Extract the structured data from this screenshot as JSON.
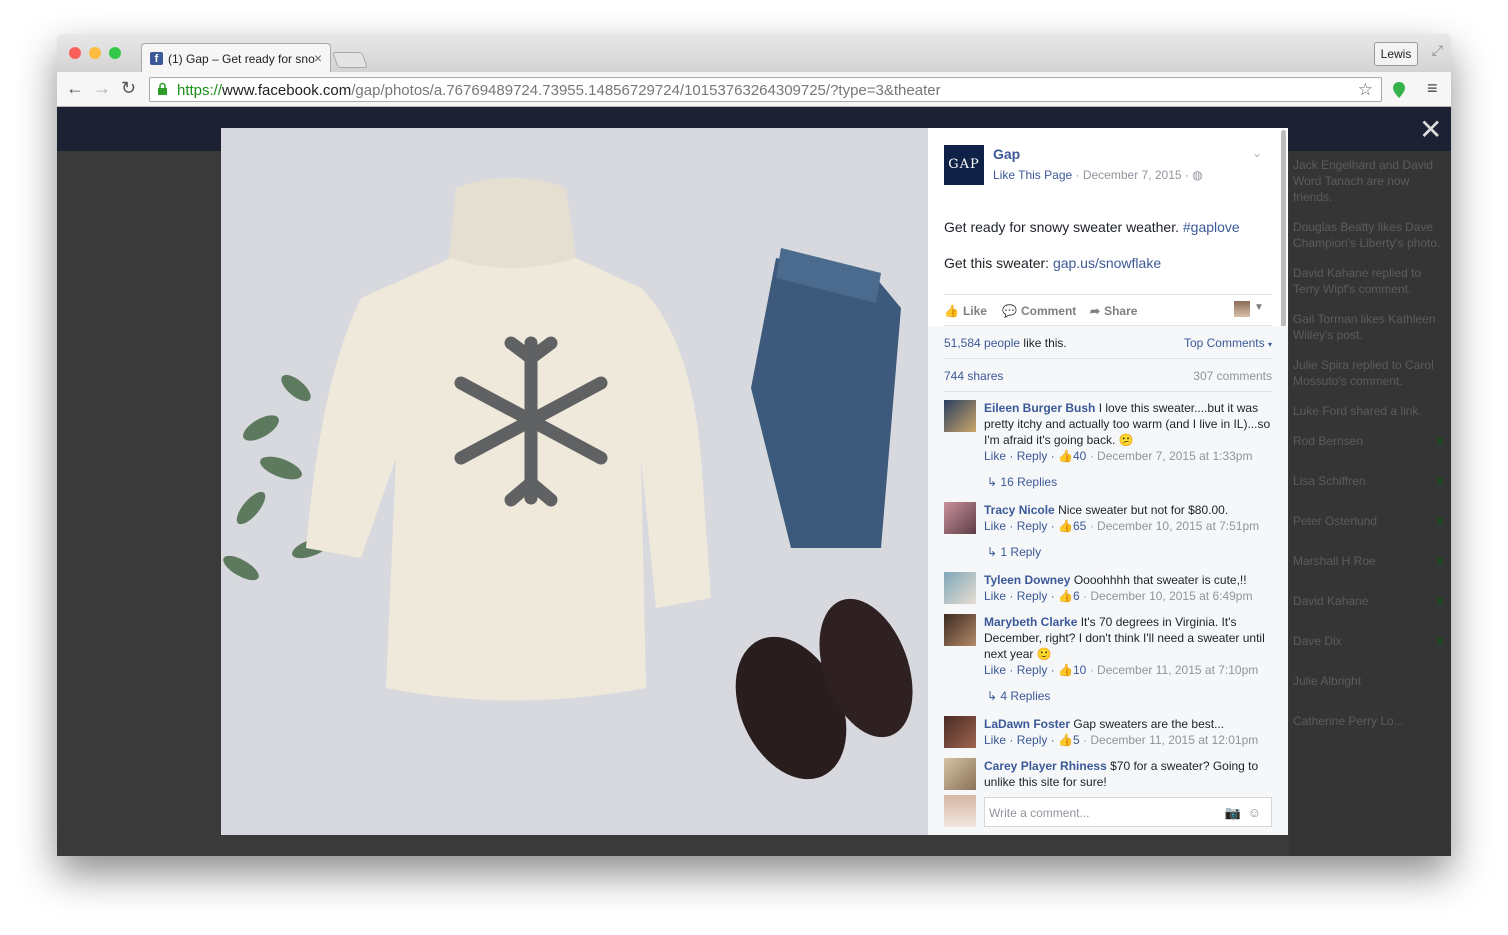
{
  "browser": {
    "tab_title": "(1) Gap – Get ready for sno",
    "user_label": "Lewis",
    "url_scheme": "https://",
    "url_host": "www.facebook.com",
    "url_path": "/gap/photos/a.76769489724.73955.14856729724/10153763264309725/?type=3&theater"
  },
  "ticker": [
    {
      "text": "Jack Engelhard and David Word Tanach are now friends."
    },
    {
      "text": "Douglas Beatty likes Dave Champion's Liberty's photo."
    },
    {
      "text": "David Kahane replied to Terry Wipf's comment."
    },
    {
      "text": "Gail Torman likes Kathleen Willey's post."
    },
    {
      "text": "Julie Spira replied to Carol Mossuto's comment."
    },
    {
      "text": "Luke Ford shared a link."
    },
    {
      "text": "Rod Bernsen"
    },
    {
      "text": "Lisa Schiffren"
    },
    {
      "text": "Peter Osterlund"
    },
    {
      "text": "Marshall H Roe"
    },
    {
      "text": "David Kahane"
    },
    {
      "text": "Dave Dix"
    },
    {
      "text": "Julie Albright"
    },
    {
      "text": "Catherine Perry Lo..."
    }
  ],
  "post": {
    "page_name": "Gap",
    "logo_text": "GAP",
    "like_page": "Like This Page",
    "date": "December 7, 2015",
    "text1": "Get ready for snowy sweater weather. ",
    "hashtag": "#gaplove",
    "text2": "Get this sweater: ",
    "link": "gap.us/snowflake"
  },
  "actions": {
    "like": "Like",
    "comment": "Comment",
    "share": "Share"
  },
  "stats": {
    "likes_link": "51,584 people",
    "likes_suffix": " like this.",
    "sort": "Top Comments",
    "shares": "744 shares",
    "comments": "307 comments"
  },
  "comments": [
    {
      "name": "Eileen Burger Bush",
      "text": "I love this sweater....but it was pretty itchy and actually too warm (and I live in IL)...so I'm afraid it's going back. 😕",
      "likes": "40",
      "date": "December 7, 2015 at 1:33pm",
      "replies": "16 Replies"
    },
    {
      "name": "Tracy Nicole",
      "text": "Nice sweater but not for $80.00.",
      "likes": "65",
      "date": "December 10, 2015 at 7:51pm",
      "replies": "1 Reply"
    },
    {
      "name": "Tyleen Downey",
      "text": "Oooohhhh that sweater is cute,!!",
      "likes": "6",
      "date": "December 10, 2015 at 6:49pm",
      "replies": ""
    },
    {
      "name": "Marybeth Clarke",
      "text": "It's 70 degrees in Virginia. It's December, right? I don't think I'll need a sweater until next year 🙂",
      "likes": "10",
      "date": "December 11, 2015 at 7:10pm",
      "replies": "4 Replies"
    },
    {
      "name": "LaDawn Foster",
      "text": "Gap sweaters are the best...",
      "likes": "5",
      "date": "December 11, 2015 at 12:01pm",
      "replies": ""
    },
    {
      "name": "Carey Player Rhiness",
      "text": "$70 for a sweater? Going to unlike this site for sure!",
      "likes": "",
      "date": "",
      "replies": ""
    }
  ],
  "labels": {
    "like": "Like",
    "reply": "Reply",
    "write_placeholder": "Write a comment..."
  }
}
